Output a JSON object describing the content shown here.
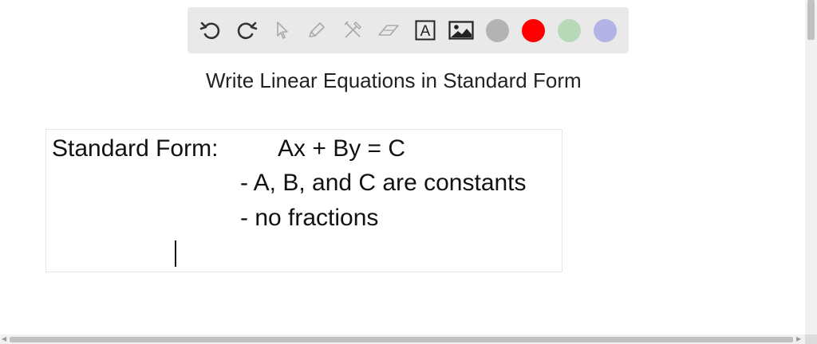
{
  "toolbar": {
    "tools": [
      {
        "icon": "undo-icon"
      },
      {
        "icon": "redo-icon"
      },
      {
        "icon": "pointer-icon"
      },
      {
        "icon": "pen-icon"
      },
      {
        "icon": "tools-icon"
      },
      {
        "icon": "eraser-icon"
      },
      {
        "icon": "text-box-icon",
        "glyph": "A"
      },
      {
        "icon": "image-icon"
      }
    ],
    "colors": [
      "#b3b3b3",
      "#ff0000",
      "#b7d9b7",
      "#b3b3e6"
    ]
  },
  "title": "Write Linear Equations in Standard Form",
  "textbox": {
    "line1_label": "Standard Form:",
    "line1_equation": "Ax + By = C",
    "line2": "- A, B, and C are constants",
    "line3": "- no fractions"
  }
}
